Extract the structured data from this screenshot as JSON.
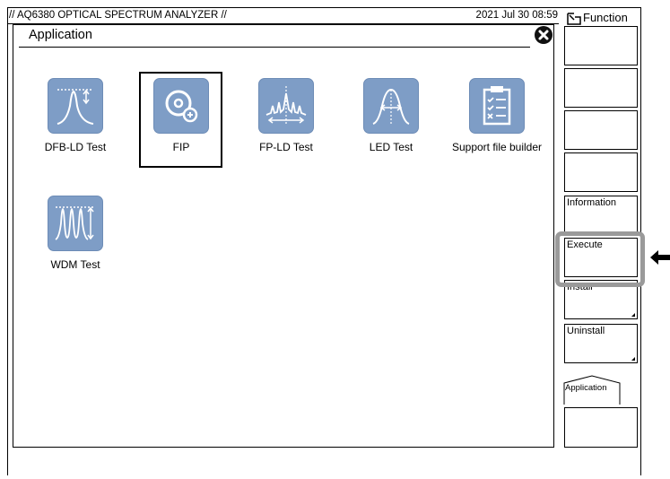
{
  "header": {
    "title": "// AQ6380 OPTICAL SPECTRUM ANALYZER //",
    "datetime": "2021 Jul 30 08:59"
  },
  "dialog": {
    "title": "Application",
    "apps": [
      {
        "label": "DFB-LD Test",
        "icon": "dfb-ld-spectrum-icon"
      },
      {
        "label": "FIP",
        "icon": "fip-magnifier-icon",
        "selected": true
      },
      {
        "label": "FP-LD Test",
        "icon": "fp-ld-spectrum-icon"
      },
      {
        "label": "LED Test",
        "icon": "led-spectrum-icon"
      },
      {
        "label": "Support file builder",
        "icon": "clipboard-checklist-icon"
      },
      {
        "label": "WDM Test",
        "icon": "wdm-spectrum-icon"
      }
    ]
  },
  "sidebar": {
    "header": "Function",
    "buttons": [
      "",
      "",
      "",
      "",
      "Information",
      "Execute",
      "Install",
      "Uninstall"
    ],
    "tab": "Application",
    "bottom": ""
  },
  "colors": {
    "icon_bg": "#7e9dc6",
    "highlight": "#9a9a9a"
  }
}
